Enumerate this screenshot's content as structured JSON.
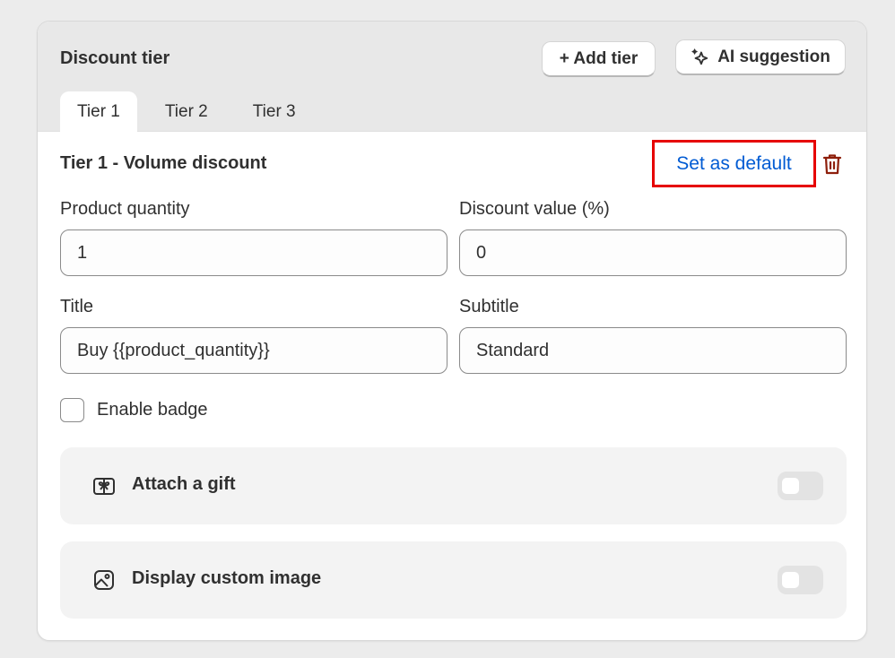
{
  "header": {
    "title": "Discount tier",
    "add_tier_label": "+ Add tier",
    "ai_suggestion_label": "AI suggestion"
  },
  "tabs": [
    {
      "label": "Tier 1",
      "active": true
    },
    {
      "label": "Tier 2",
      "active": false
    },
    {
      "label": "Tier 3",
      "active": false
    }
  ],
  "tier": {
    "title": "Tier 1 - Volume discount",
    "set_default_label": "Set as default"
  },
  "fields": {
    "product_quantity": {
      "label": "Product quantity",
      "value": "1"
    },
    "discount_value": {
      "label": "Discount value (%)",
      "value": "0"
    },
    "title": {
      "label": "Title",
      "value": "Buy {{product_quantity}}"
    },
    "subtitle": {
      "label": "Subtitle",
      "value": "Standard"
    }
  },
  "badge": {
    "label": "Enable badge",
    "checked": false
  },
  "options": [
    {
      "label": "Attach a gift",
      "icon": "gift-icon",
      "enabled": false
    },
    {
      "label": "Display custom image",
      "icon": "image-icon",
      "enabled": false
    }
  ],
  "colors": {
    "link": "#005bd3",
    "highlight": "#e60000",
    "delete": "#8e1f0b",
    "header_bg": "#e8e8e8"
  }
}
